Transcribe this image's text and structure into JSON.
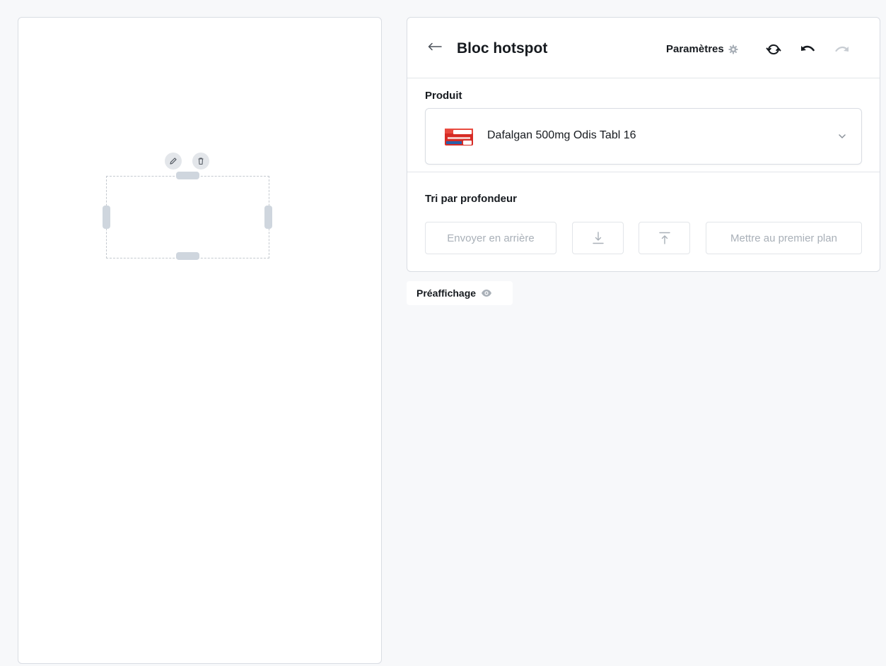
{
  "editor": {
    "title": "Bloc hotspot",
    "settings_label": "Paramètres"
  },
  "product": {
    "label": "Produit",
    "selected": "Dafalgan 500mg Odis Tabl 16"
  },
  "depth": {
    "label": "Tri par profondeur",
    "send_back_label": "Envoyer en arrière",
    "bring_front_label": "Mettre au premier plan"
  },
  "preview": {
    "label": "Préaffichage"
  },
  "icons": {
    "back": "arrow-left-icon",
    "settings": "gear-icon",
    "sync": "sync-icon",
    "undo": "undo-icon",
    "redo": "redo-icon",
    "chevron": "chevron-down-icon",
    "edit": "pencil-icon",
    "delete": "trash-icon",
    "move_backward": "arrow-down-to-line-icon",
    "move_forward": "arrow-up-to-line-icon",
    "preview": "eye-icon"
  },
  "colors": {
    "background": "#f7f8fa",
    "border": "#d9dde3",
    "handle": "#cfd6de",
    "disabled_text": "#a9b0b8",
    "text": "#161a1f"
  }
}
